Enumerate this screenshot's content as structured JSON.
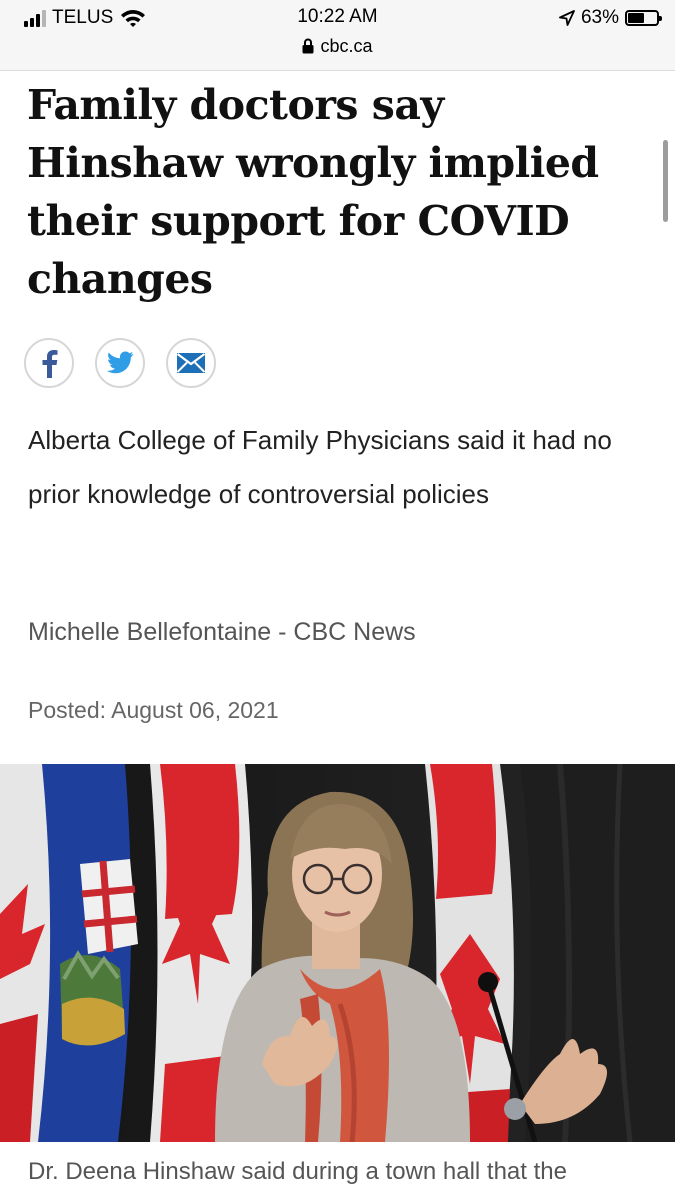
{
  "status_bar": {
    "carrier": "TELUS",
    "time": "10:22 AM",
    "url": "cbc.ca",
    "battery_percent": "63%",
    "battery_level": 0.63,
    "signal_bars": 3
  },
  "article": {
    "headline": "Family doctors say Hinshaw wrongly implied their support for COVID changes",
    "deck": "Alberta College of Family Physicians said it had no prior knowledge of controversial policies",
    "byline": "Michelle Bellefontaine - CBC News",
    "posted": "Posted: August 06, 2021",
    "caption": "Dr. Deena Hinshaw said during a town hall that the"
  },
  "share": {
    "icons": [
      "facebook-icon",
      "twitter-icon",
      "email-icon"
    ]
  },
  "colors": {
    "twitter": "#2f9ee6",
    "facebook": "#3b5a99",
    "email": "#1d6fb8",
    "flag_red": "#d8262c",
    "alberta_blue": "#1f3f9c"
  }
}
